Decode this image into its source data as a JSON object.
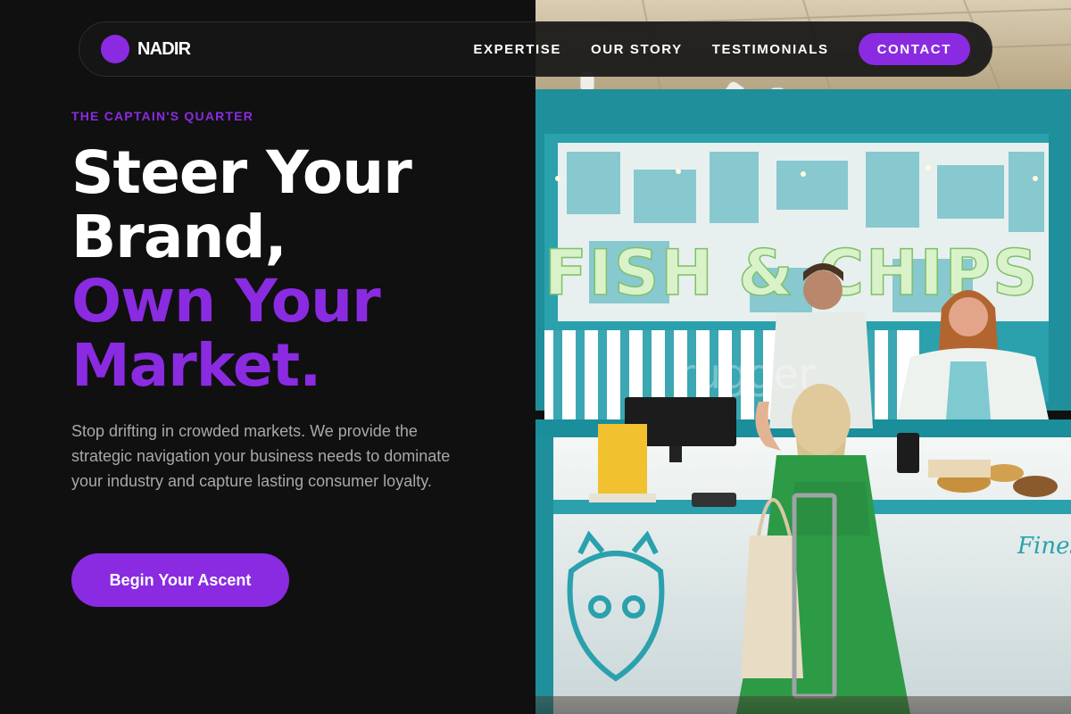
{
  "brand": {
    "name": "NADIR",
    "accent_color": "#8a2be2"
  },
  "nav": {
    "links": [
      {
        "label": "EXPERTISE"
      },
      {
        "label": "OUR STORY"
      },
      {
        "label": "TESTIMONIALS"
      }
    ],
    "contact_label": "CONTACT"
  },
  "hero": {
    "eyebrow": "THE CAPTAIN'S QUARTER",
    "headline": {
      "line1": "Steer Your",
      "line2": "Brand,",
      "line3": "Own Your",
      "line4": "Market."
    },
    "lead": "Stop drifting in crowded markets. We provide the strategic navigation your business needs to dominate your industry and capture lasting consumer loyalty.",
    "cta_label": "Begin Your Ascent"
  },
  "photo": {
    "subject": "fish-and-chips-kiosk",
    "sign_text": "FISH & CHIPS",
    "counter_text": "Fines",
    "watermark": "rugger"
  }
}
